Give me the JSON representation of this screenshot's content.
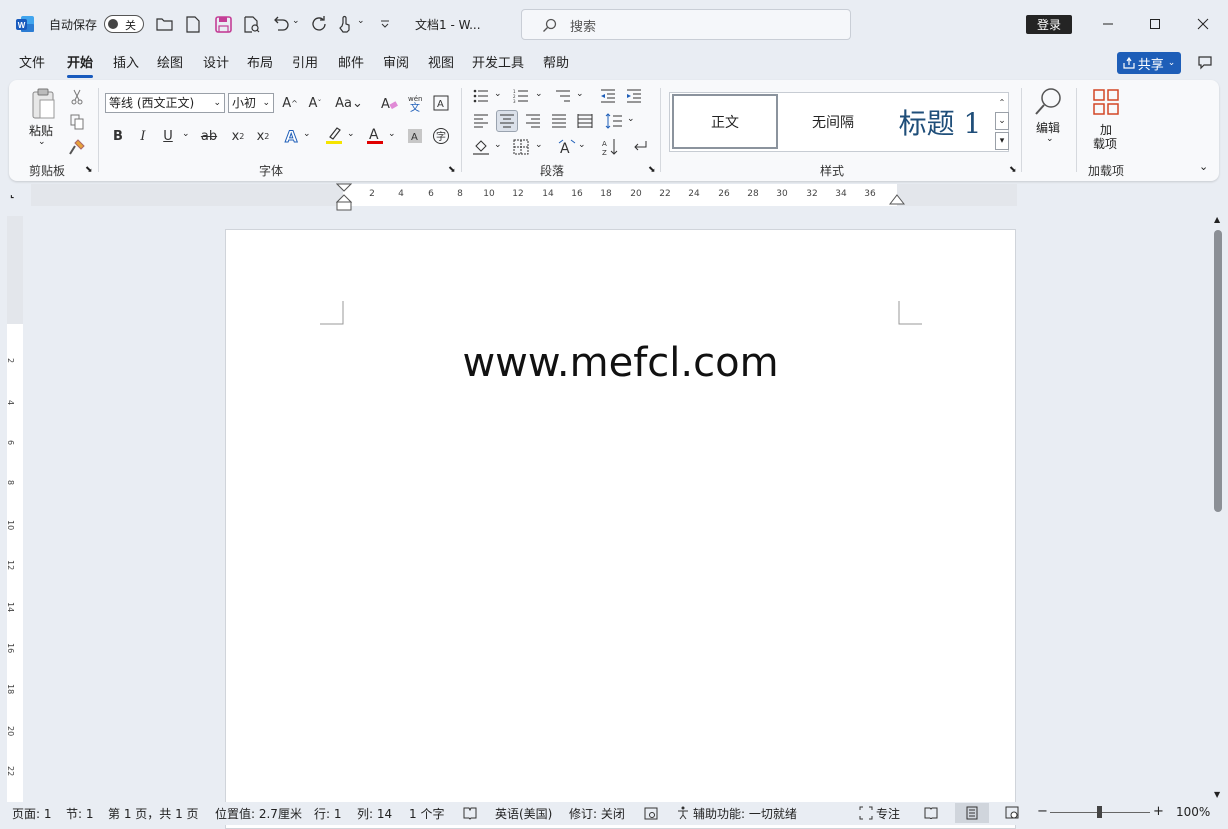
{
  "titlebar": {
    "autosave_label": "自动保存",
    "autosave_state": "关",
    "doc_title": "文档1  -  W...",
    "search_placeholder": "搜索",
    "login_label": "登录"
  },
  "menu": {
    "tabs": [
      "文件",
      "开始",
      "插入",
      "绘图",
      "设计",
      "布局",
      "引用",
      "邮件",
      "审阅",
      "视图",
      "开发工具",
      "帮助"
    ],
    "active_tab": "开始",
    "share_label": "共享"
  },
  "ribbon": {
    "clipboard": {
      "paste_label": "粘贴",
      "group_label": "剪贴板"
    },
    "font": {
      "font_name": "等线 (西文正文)",
      "font_size": "小初",
      "group_label": "字体",
      "highlight_color": "#f5e400",
      "font_color": "#e00000"
    },
    "paragraph": {
      "group_label": "段落"
    },
    "styles": {
      "items": [
        "正文",
        "无间隔",
        "标题 1"
      ],
      "group_label": "样式"
    },
    "editing": {
      "label": "编辑"
    },
    "addins": {
      "button_label_line1": "加",
      "button_label_line2": "载项",
      "group_label": "加载项"
    }
  },
  "ruler": {
    "ticks": [
      "2",
      "4",
      "6",
      "8",
      "10",
      "12",
      "14",
      "16",
      "18",
      "20",
      "22",
      "24",
      "26",
      "28",
      "30",
      "32",
      "34",
      "36"
    ]
  },
  "vruler": {
    "ticks": [
      "2",
      "4",
      "6",
      "8",
      "10",
      "12",
      "14",
      "16",
      "18",
      "20",
      "22"
    ]
  },
  "document": {
    "text": "www.mefcl.com"
  },
  "statusbar": {
    "page": "页面: 1",
    "section": "节: 1",
    "page_of": "第 1 页，共 1 页",
    "position": "位置值: 2.7厘米",
    "line": "行: 1",
    "column": "列: 14",
    "word_count": "1 个字",
    "language": "英语(美国)",
    "track_changes": "修订: 关闭",
    "accessibility": "辅助功能: 一切就绪",
    "focus": "专注",
    "zoom": "100%"
  },
  "colors": {
    "accent": "#185abd",
    "word_icon": "#185abd",
    "save_icon": "#c43e96"
  }
}
